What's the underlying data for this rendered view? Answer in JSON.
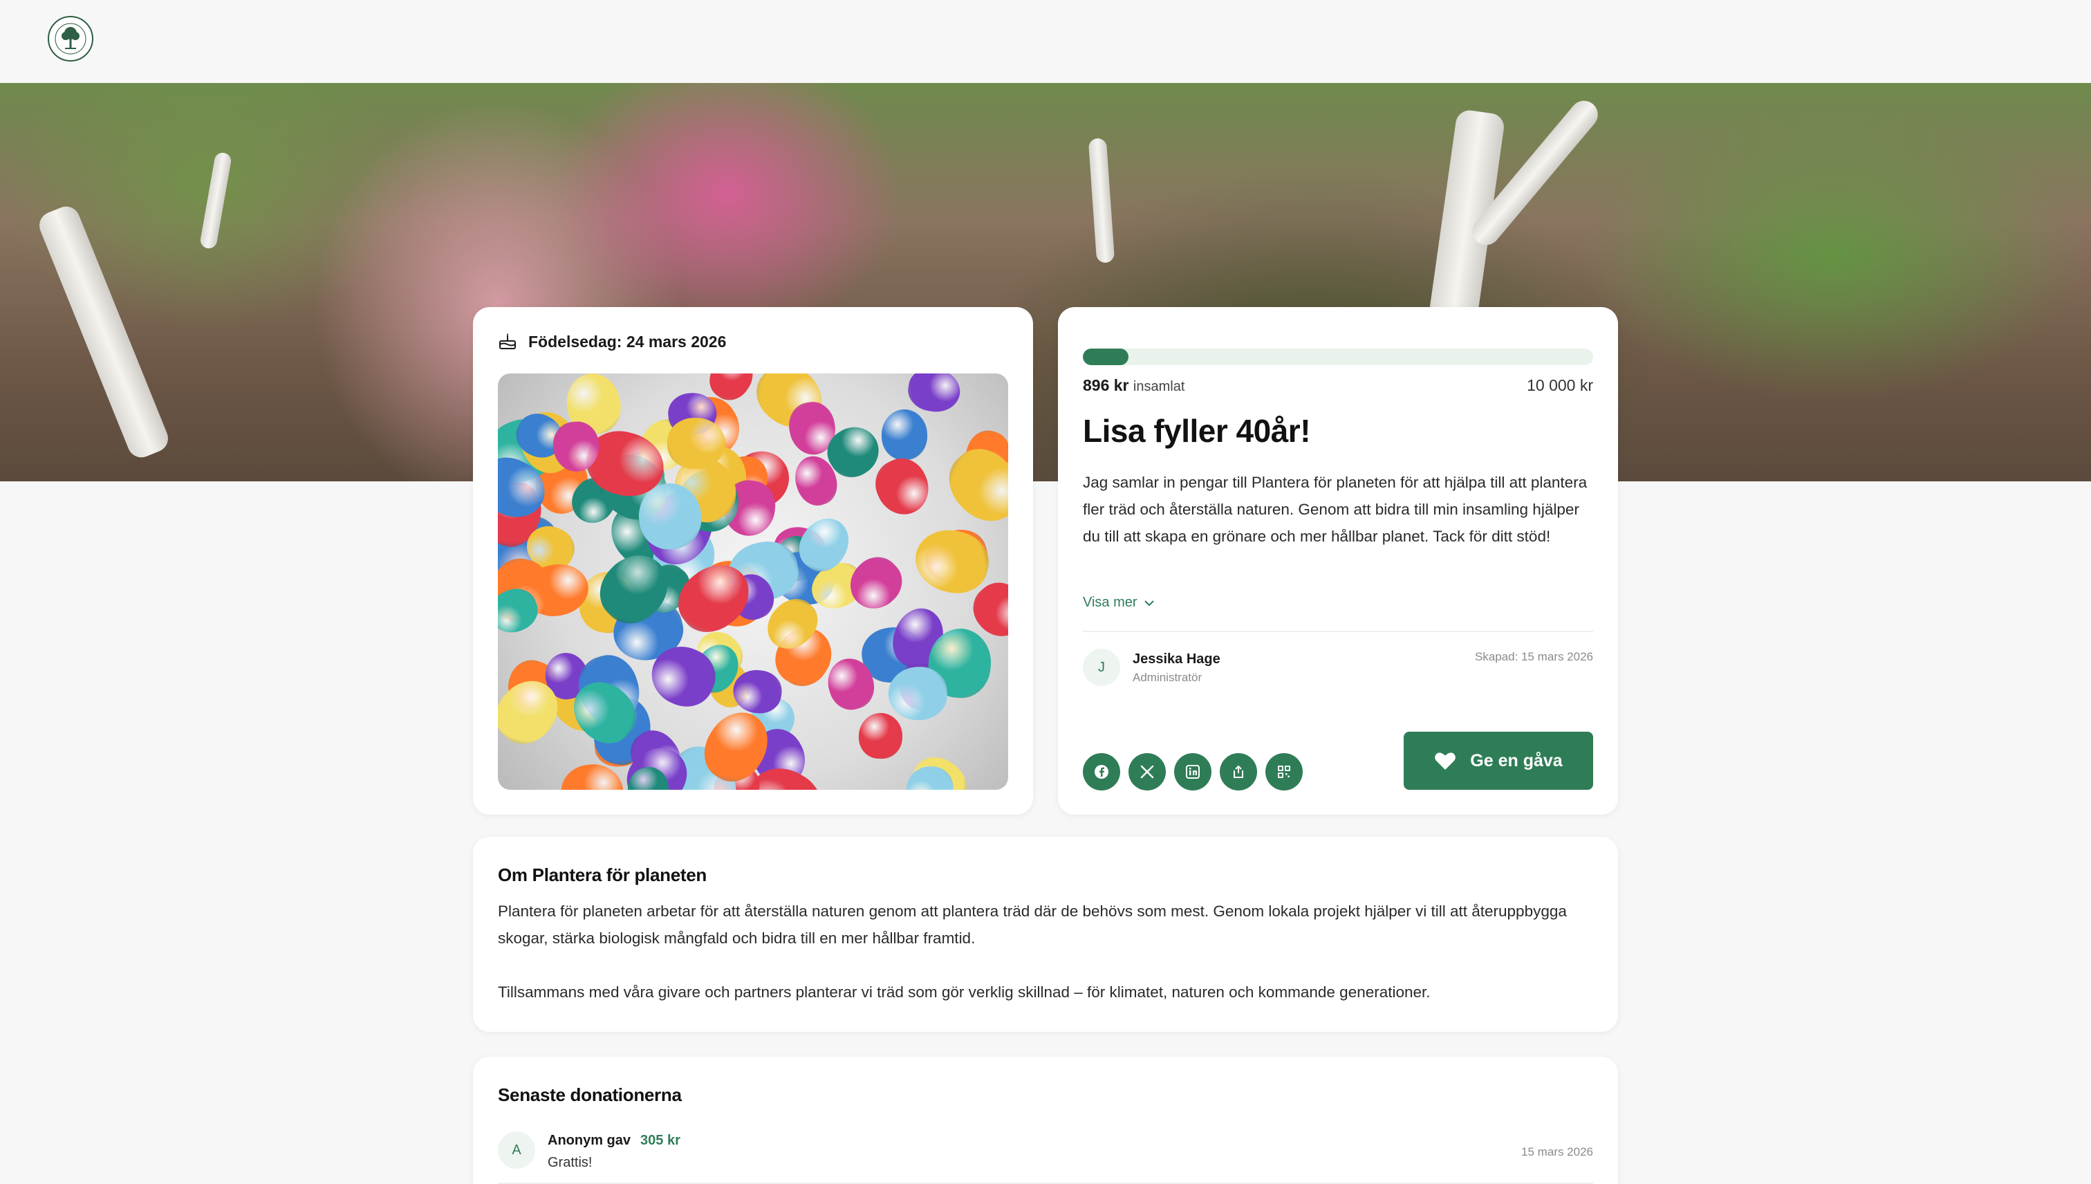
{
  "header": {
    "logo_name": "Plantera för planeten"
  },
  "event": {
    "occasion_label": "Födelsedag: 24 mars 2026"
  },
  "fundraiser": {
    "raised_amount": "896 kr",
    "raised_label": "insamlat",
    "goal_amount": "10 000 kr",
    "progress_fraction": 0.0896,
    "title": "Lisa fyller 40år!",
    "description": "Jag samlar in pengar till Plantera för planeten för att hjälpa till att plantera fler träd och återställa naturen. Genom att bidra till min insamling hjälper du till att skapa en grönare och mer hållbar planet. Tack för ditt stöd!",
    "show_more_label": "Visa mer",
    "admin": {
      "initial": "J",
      "name": "Jessika Hage",
      "role": "Administratör"
    },
    "created_label": "Skapad: 15 mars 2026",
    "share_icons": [
      "facebook-icon",
      "x-icon",
      "linkedin-icon",
      "share-icon",
      "qr-code-icon"
    ],
    "give_button_label": "Ge en gåva"
  },
  "about": {
    "title": "Om Plantera för planeten",
    "paragraph_1": "Plantera för planeten arbetar för att återställa naturen genom att plantera träd där de behövs som mest. Genom lokala projekt hjälper vi till att återuppbygga skogar, stärka biologisk mångfald och bidra till en mer hållbar framtid.",
    "paragraph_2": "Tillsammans med våra givare och partners planterar vi träd som gör verklig skillnad – för klimatet, naturen och kommande generationer."
  },
  "donations": {
    "title": "Senaste donationerna",
    "items": [
      {
        "initial": "A",
        "name": "Anonym gav",
        "amount": "305 kr",
        "message": "Grattis!",
        "date": "15 mars 2026"
      }
    ]
  },
  "colors": {
    "brand_green": "#2f7d57",
    "progress_track": "#eaf2ec",
    "page_bg": "#f7f7f7"
  }
}
